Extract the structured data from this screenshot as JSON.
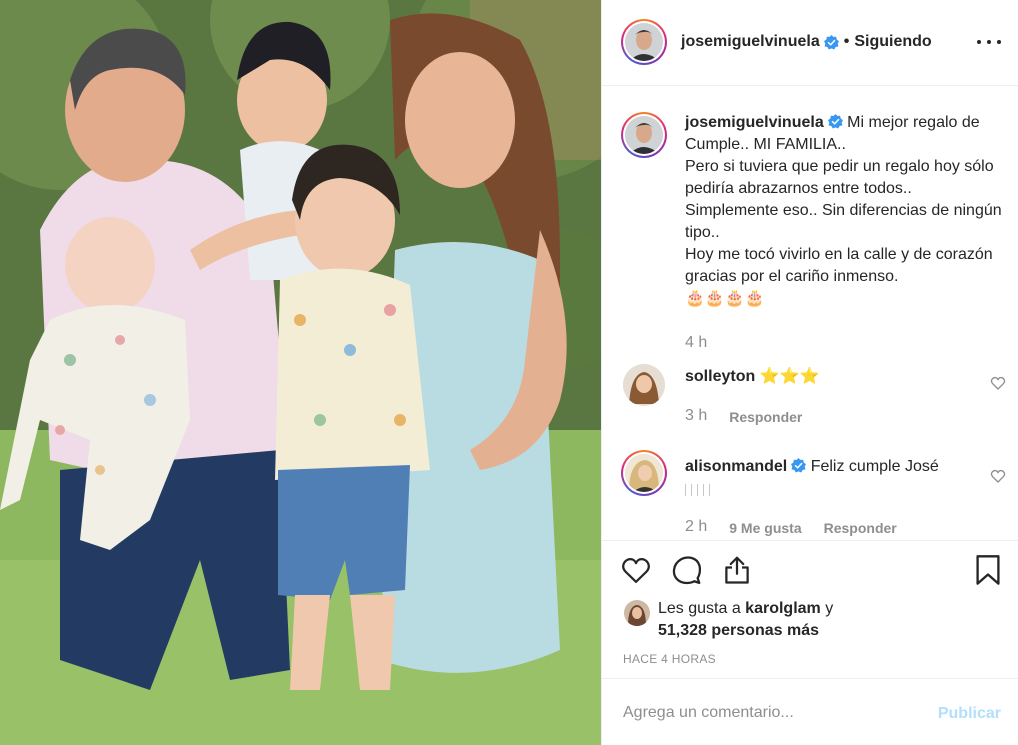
{
  "post": {
    "username": "josemiguelvinuela",
    "separator": "•",
    "follow_status": "Siguiendo"
  },
  "caption": {
    "username": "josemiguelvinuela",
    "text": " Mi mejor regalo de Cumple.. MI FAMILIA..\nPero si tuviera que pedir un regalo hoy sólo pediría abrazarnos entre todos.. Simplemente eso.. Sin diferencias de ningún tipo..\nHoy me tocó vivirlo en la calle y de corazón gracias por el cariño inmenso.\n🎂🎂🎂🎂",
    "time": "4 h"
  },
  "comments": [
    {
      "username": "solleyton",
      "text": " ⭐⭐⭐",
      "time": "3 h",
      "reply": "Responder"
    },
    {
      "username": "alisonmandel",
      "text": " Feliz cumple José",
      "time": "2 h",
      "likes": "9 Me gusta",
      "reply": "Responder"
    }
  ],
  "likes": {
    "prefix": "Les gusta a ",
    "user": "karolglam",
    "connector": " y",
    "count": "51,328 personas más"
  },
  "posted_ago": "HACE 4 HORAS",
  "add_comment": {
    "placeholder": "Agrega un comentario...",
    "publish": "Publicar"
  },
  "icons": {
    "verified": "verified-badge-icon",
    "more": "more-options-icon",
    "like": "heart-icon",
    "comment": "comment-bubble-icon",
    "share": "share-icon",
    "save": "bookmark-icon"
  },
  "colors": {
    "verified_blue": "#3897f0",
    "publish_disabled": "#b2dffc",
    "muted": "#8e8e8e"
  }
}
